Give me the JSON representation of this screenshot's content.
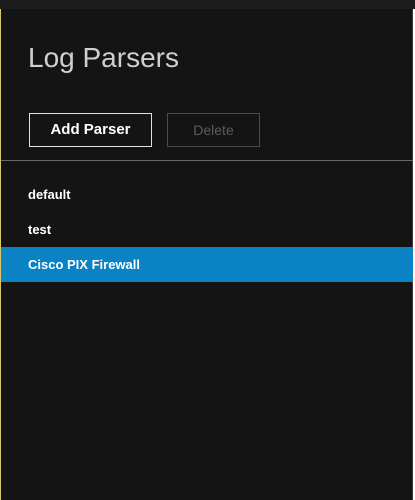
{
  "panel": {
    "title": "Log Parsers"
  },
  "toolbar": {
    "add_label": "Add Parser",
    "delete_label": "Delete"
  },
  "parsers": {
    "items": [
      {
        "label": "default",
        "selected": false
      },
      {
        "label": "test",
        "selected": false
      },
      {
        "label": "Cisco PIX Firewall",
        "selected": true
      }
    ]
  },
  "colors": {
    "background": "#141414",
    "selection": "#0a82c4",
    "accent_border": "#d9c86a"
  }
}
